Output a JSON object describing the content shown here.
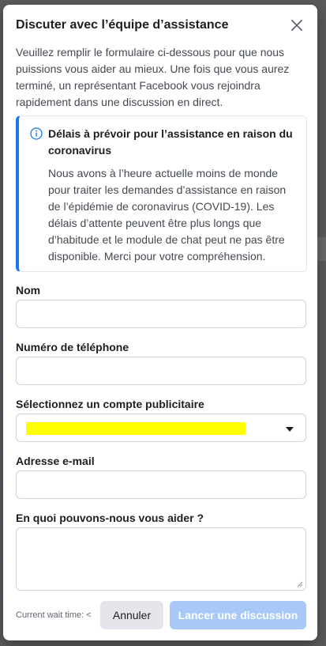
{
  "dialog": {
    "title": "Discuter avec l’équipe d’assistance",
    "intro": "Veuillez remplir le formulaire ci-dessous pour que nous puissions vous aider au mieux. Une fois que vous aurez terminé, un représentant Facebook vous rejoindra rapidement dans une discussion en direct."
  },
  "notice": {
    "icon": "info-icon",
    "title": "Délais à prévoir pour l’assistance en raison du coronavirus",
    "body": "Nous avons à l’heure actuelle moins de monde pour traiter les demandes d’assistance en raison de l’épidémie de coronavirus (COVID-19). Les délais d’attente peuvent être plus longs que d’habitude et le module de chat peut ne pas être disponible. Merci pour votre compréhension.",
    "accent_color": "#1877f2"
  },
  "form": {
    "name_label": "Nom",
    "name_value": "",
    "phone_label": "Numéro de téléphone",
    "phone_value": "",
    "ad_account_label": "Sélectionnez un compte publicitaire",
    "ad_account_value": "",
    "email_label": "Adresse e-mail",
    "email_value": "",
    "help_label": "En quoi pouvons-nous vous aider ?",
    "help_value": ""
  },
  "footer": {
    "wait_time": "Current wait time: <",
    "cancel_label": "Annuler",
    "start_label": "Lancer une discussion"
  },
  "colors": {
    "primary_disabled": "#a8c9f7",
    "redaction": "#ffff00"
  }
}
